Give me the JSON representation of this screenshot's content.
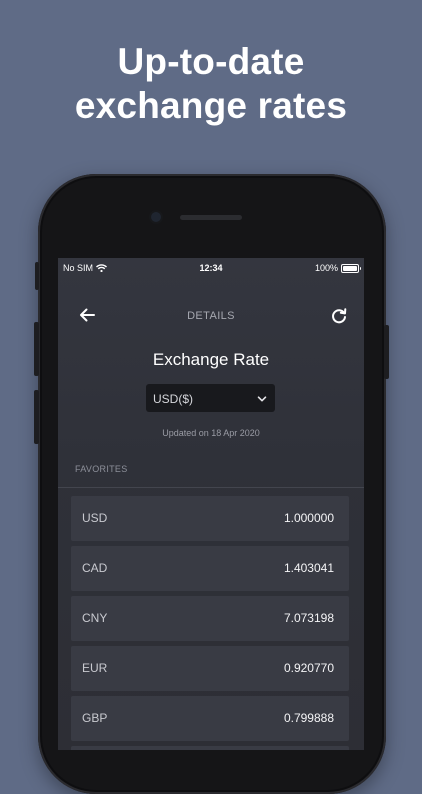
{
  "headline": {
    "line1": "Up-to-date",
    "line2": "exchange rates"
  },
  "status_bar": {
    "carrier": "No SIM",
    "time": "12:34",
    "battery": "100%"
  },
  "nav": {
    "title": "DETAILS",
    "back_icon": "arrow-left-icon",
    "refresh_icon": "refresh-icon"
  },
  "page": {
    "title": "Exchange Rate",
    "selected_currency": "USD($)",
    "updated_text": "Updated on 18 Apr 2020"
  },
  "favorites": {
    "label": "FAVORITES",
    "rows": [
      {
        "code": "USD",
        "rate": "1.000000"
      },
      {
        "code": "CAD",
        "rate": "1.403041"
      },
      {
        "code": "CNY",
        "rate": "7.073198"
      },
      {
        "code": "EUR",
        "rate": "0.920770"
      },
      {
        "code": "GBP",
        "rate": "0.799888"
      }
    ]
  },
  "colors": {
    "background": "#5f6b86",
    "screen": "#2f3139",
    "row": "#393b44",
    "select": "#18191d"
  }
}
